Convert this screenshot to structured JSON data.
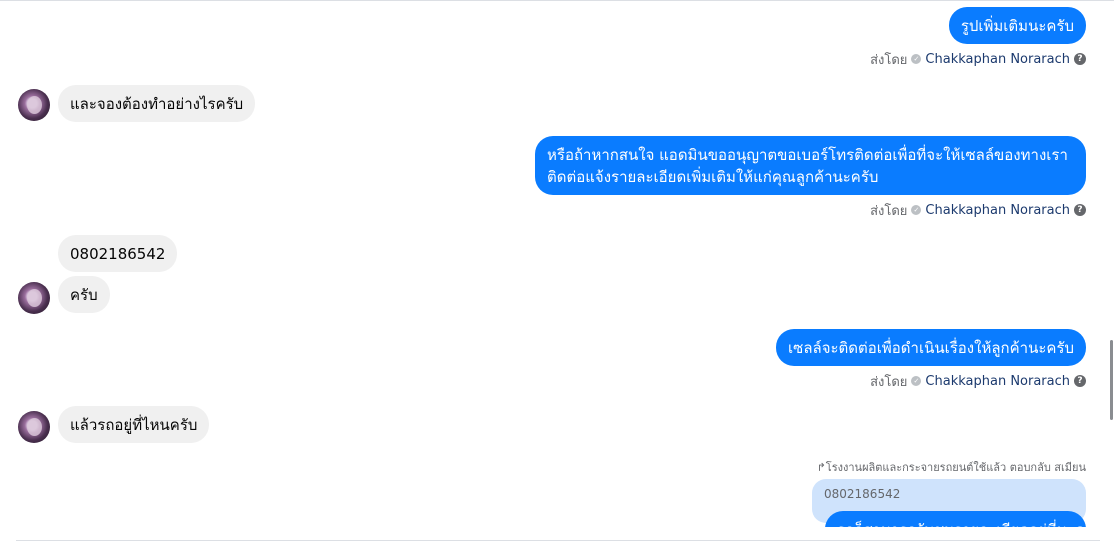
{
  "messages": {
    "m1": {
      "text": "รูปเพิ่มเติมนะครับ"
    },
    "m2": {
      "text": "และจองต้องทำอย่างไรครับ"
    },
    "m3": {
      "line1": "หรือถ้าหากสนใจ แอดมินขออนุญาตขอเบอร์โทรติดต่อเพื่อที่จะให้เซลล์ของทางเรา",
      "line2": "ติดต่อแจ้งรายละเอียดเพิ่มเติมให้แก่คุณลูกค้านะครับ"
    },
    "m4": {
      "text": "0802186542"
    },
    "m5": {
      "text": "ครับ"
    },
    "m6": {
      "text": "เซลล์จะติดต่อเพื่อดำเนินเรื่องให้ลูกค้านะครับ"
    },
    "m7": {
      "text": "แล้วรถอยู่ที่ไหนครับ"
    },
    "m8": {
      "text": "รถก็สามารถรับชมรายละเอียดอยู่ที่นะครับ"
    }
  },
  "sent_by": {
    "label": "ส่งโดย",
    "name": "Chakkaphan Norarach",
    "check_glyph": "✓",
    "help_glyph": "?"
  },
  "reply": {
    "label": "↱โรงงานผลิตและกระจายรถยนต์ใช้แล้ว ตอบกลับ สเมียน",
    "quoted_text": "0802186542"
  },
  "colors": {
    "outgoing_bubble": "#0a7cff",
    "incoming_bubble": "#f0f0f0",
    "reply_quote_bg": "#cfe3fc",
    "meta_text": "#65676b"
  },
  "icons": {
    "avatar": "user-avatar",
    "check": "check-circle-icon",
    "help": "question-circle-icon"
  }
}
